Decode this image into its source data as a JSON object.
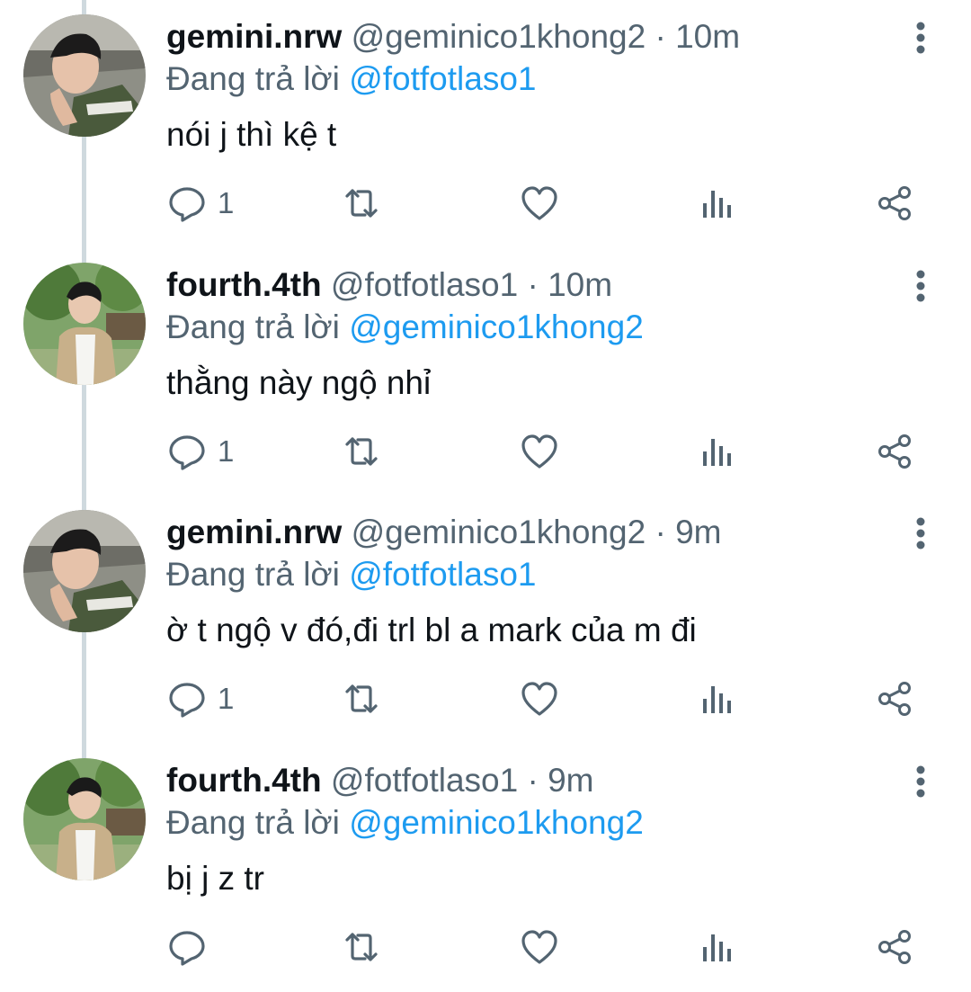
{
  "colors": {
    "text": "#0f1419",
    "muted": "#536471",
    "mention": "#1d9bf0",
    "thread_line": "#cfd9de"
  },
  "tweets": [
    {
      "display_name": "gemini.nrw",
      "handle": "@geminico1khong2",
      "sep": "·",
      "time": "10m",
      "reply_prefix": "Đang trả lời",
      "reply_to": "@fotfotlaso1",
      "text": "nói j thì kệ t",
      "reply_count": "1",
      "avatar": "avatar-gemini"
    },
    {
      "display_name": "fourth.4th",
      "handle": "@fotfotlaso1",
      "sep": "·",
      "time": "10m",
      "reply_prefix": "Đang trả lời",
      "reply_to": "@geminico1khong2",
      "text": "thằng này ngộ nhỉ",
      "reply_count": "1",
      "avatar": "avatar-fourth"
    },
    {
      "display_name": "gemini.nrw",
      "handle": "@geminico1khong2",
      "sep": "·",
      "time": "9m",
      "reply_prefix": "Đang trả lời",
      "reply_to": "@fotfotlaso1",
      "text": "ờ t ngộ v đó,đi trl bl a mark của m đi",
      "reply_count": "1",
      "avatar": "avatar-gemini"
    },
    {
      "display_name": "fourth.4th",
      "handle": "@fotfotlaso1",
      "sep": "·",
      "time": "9m",
      "reply_prefix": "Đang trả lời",
      "reply_to": "@geminico1khong2",
      "text": "bị j z tr",
      "reply_count": "",
      "avatar": "avatar-fourth"
    }
  ],
  "icons": [
    "reply-icon",
    "retweet-icon",
    "like-icon",
    "analytics-icon",
    "share-icon",
    "more-icon"
  ]
}
